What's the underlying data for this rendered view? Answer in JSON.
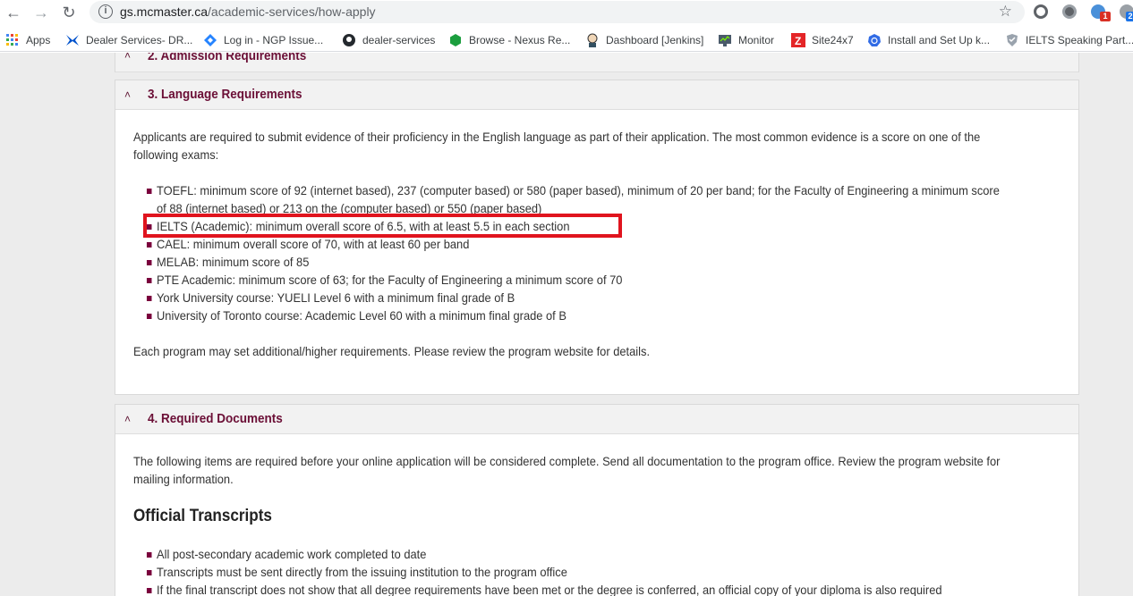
{
  "browser": {
    "url_host": "gs.mcmaster.ca",
    "url_path": "/academic-services/how-apply",
    "back_glyph": "←",
    "forward_glyph": "→",
    "reload_glyph": "↻",
    "star_glyph": "☆",
    "info_glyph": "i",
    "ext_badge": "1",
    "ext_badge2": "2"
  },
  "bookmarks": [
    {
      "label": "Apps",
      "icon": "apps-grid-icon"
    },
    {
      "label": "Dealer Services- DR...",
      "icon": "dealer-butterfly-icon"
    },
    {
      "label": "Log in - NGP Issue...",
      "icon": "jira-diamond-icon"
    },
    {
      "label": "dealer-services",
      "icon": "github-icon"
    },
    {
      "label": "Browse - Nexus Re...",
      "icon": "nexus-hexagon-icon"
    },
    {
      "label": "Dashboard [Jenkins]",
      "icon": "jenkins-icon"
    },
    {
      "label": "Monitor",
      "icon": "monitor-icon"
    },
    {
      "label": "Site24x7",
      "icon": "site24x7-icon"
    },
    {
      "label": "Install and Set Up k...",
      "icon": "kubernetes-icon"
    },
    {
      "label": "IELTS Speaking Part...",
      "icon": "ielts-shield-icon"
    }
  ],
  "panels": {
    "admission": {
      "title": "2. Admission Requirements"
    },
    "language": {
      "title": "3. Language Requirements",
      "intro_line1": "Applicants are required to submit evidence of their proficiency in the English language as part of their application. The most common evidence is a score on one of the",
      "intro_line2": "following exams:",
      "items": [
        "TOEFL: minimum score of 92 (internet based), 237 (computer based) or 580 (paper based), minimum of 20 per band; for the Faculty of Engineering a minimum score",
        "of 88 (internet based) or 213 on the (computer based) or 550 (paper based)",
        "IELTS (Academic): minimum overall score of 6.5, with at least 5.5 in each section",
        "CAEL: minimum overall score of 70, with at least 60 per band",
        "MELAB: minimum score of 85",
        "PTE Academic: minimum score of 63; for the Faculty of Engineering a minimum score of 70",
        "York University course: YUELI Level 6 with a minimum final grade of B",
        "University of Toronto course: Academic Level 60 with a minimum final grade of B"
      ],
      "footer": "Each program may set additional/higher requirements. Please review the program website for details."
    },
    "documents": {
      "title": "4. Required Documents",
      "intro_line1": "The following items are required before your online application will be considered complete. Send all documentation to the program office. Review the program website for",
      "intro_line2": "mailing information.",
      "subheading": "Official Transcripts",
      "items": [
        "All post-secondary academic work completed to date",
        "Transcripts must be sent directly from the issuing institution to the program office",
        "If the final transcript does not show that all degree requirements have been met or the degree is conferred, an official copy of your diploma is also required"
      ]
    }
  },
  "colors": {
    "accent": "#7a003c",
    "highlight": "#e0141e"
  }
}
